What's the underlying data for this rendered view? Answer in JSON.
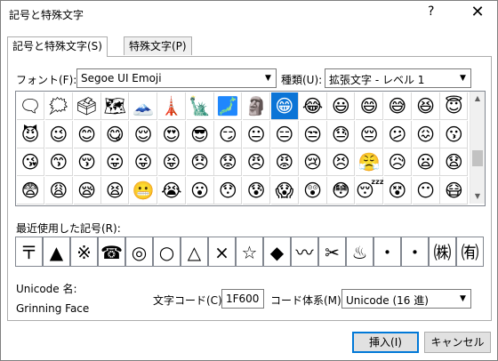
{
  "window": {
    "title": "記号と特殊文字",
    "help_label": "?",
    "close_label": "✕"
  },
  "tabs": [
    {
      "label": "記号と特殊文字(S)",
      "active": true
    },
    {
      "label": "特殊文字(P)",
      "active": false
    }
  ],
  "font": {
    "label": "フォント(F):",
    "value": "Segoe UI Emoji"
  },
  "subset": {
    "label": "種類(U):",
    "value": "拡張文字 - レベル 1"
  },
  "symbols": [
    [
      "🗨",
      "🗯",
      "🗳",
      "🗺",
      "🗻",
      "🗼",
      "🗽",
      "🗾",
      "🗿",
      "😁",
      "😂",
      "😃",
      "😄",
      "😅",
      "😆",
      "😇"
    ],
    [
      "😈",
      "😉",
      "😊",
      "😋",
      "😌",
      "😍",
      "😎",
      "😏",
      "😐",
      "😑",
      "😒",
      "😓",
      "😔",
      "😕",
      "😖",
      "😗"
    ],
    [
      "😘",
      "😙",
      "😚",
      "😛",
      "😜",
      "😝",
      "😞",
      "😟",
      "😠",
      "😡",
      "😢",
      "😣",
      "😤",
      "😥",
      "😦",
      "😧"
    ],
    [
      "😨",
      "😩",
      "😪",
      "😫",
      "😬",
      "😭",
      "😮",
      "😯",
      "😰",
      "😱",
      "😲",
      "😳",
      "😴",
      "😵",
      "😶",
      "😷"
    ]
  ],
  "selected_symbol": "😁",
  "recent": {
    "label": "最近使用した記号(R):",
    "items": [
      "〒",
      "▲",
      "※",
      "☎",
      "◎",
      "○",
      "△",
      "×",
      "☆",
      "◆",
      "〰",
      "✂",
      "♨",
      "・",
      "・",
      "㈱",
      "㈲"
    ]
  },
  "unicode_name_label": "Unicode 名:",
  "unicode_name": "Grinning Face",
  "char_code": {
    "label": "文字コード(C):",
    "value": "1F600"
  },
  "code_system": {
    "label": "コード体系(M):",
    "value": "Unicode (16 進)"
  },
  "buttons": {
    "insert": "挿入(I)",
    "cancel": "キャンセル"
  }
}
